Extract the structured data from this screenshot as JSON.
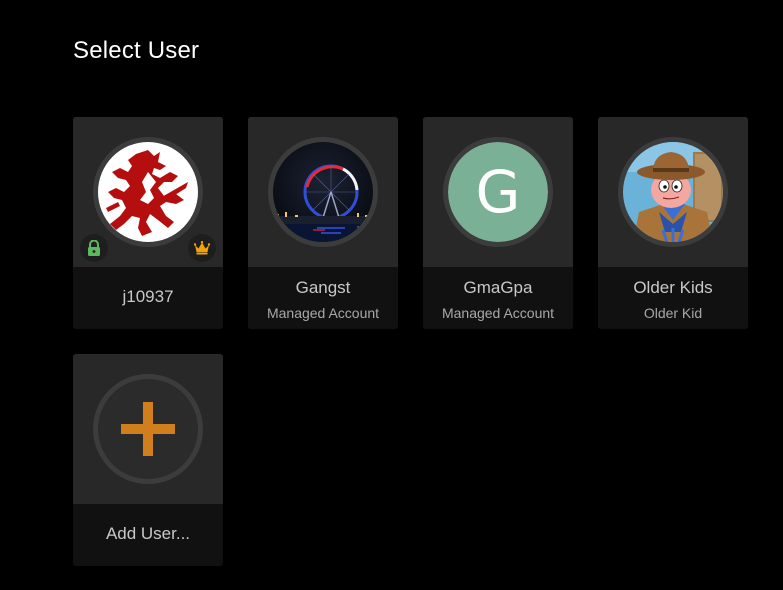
{
  "page": {
    "title": "Select User"
  },
  "users": [
    {
      "name": "j10937",
      "subtitle": "",
      "avatar_kind": "lion-crest",
      "badges": [
        "lock-icon",
        "crown-icon"
      ]
    },
    {
      "name": "Gangst",
      "subtitle": "Managed Account",
      "avatar_kind": "ferris-wheel-photo"
    },
    {
      "name": "GmaGpa",
      "subtitle": "Managed Account",
      "avatar_kind": "letter",
      "avatar_letter": "G",
      "avatar_color": "#7ab096"
    },
    {
      "name": "Older Kids",
      "subtitle": "Older Kid",
      "avatar_kind": "cartoon-cowboy"
    }
  ],
  "add_user": {
    "label": "Add User...",
    "icon": "plus-icon",
    "icon_color": "#d17f1c"
  },
  "colors": {
    "background": "#000000",
    "card_top": "#282828",
    "card_bottom": "#111111",
    "lock_badge": "#5cb85c",
    "crown_badge": "#f0a30a",
    "lion_red": "#b40e0e"
  }
}
